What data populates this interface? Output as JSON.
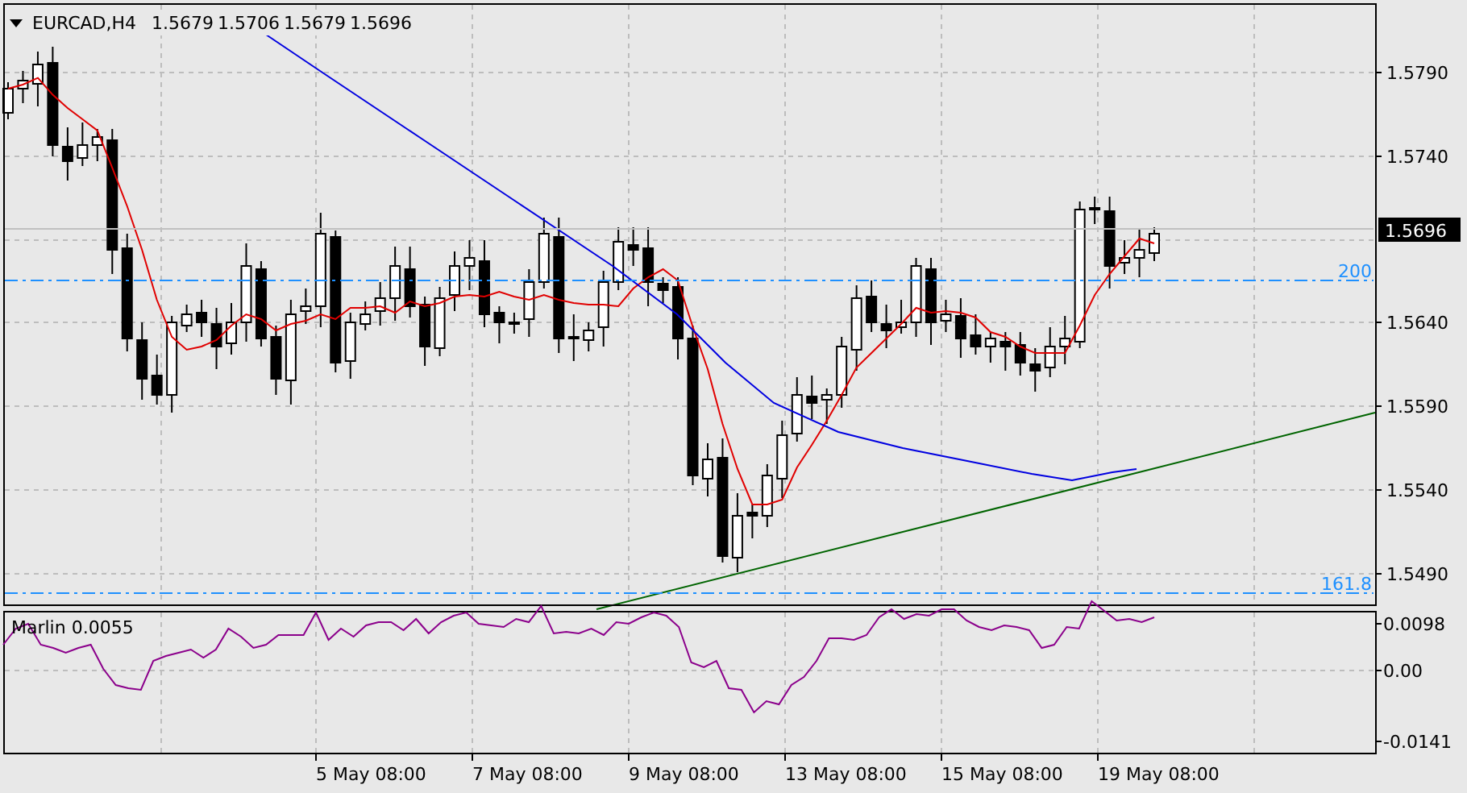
{
  "header": {
    "symbol": "EURCAD,H4",
    "quotes": [
      "1.5679",
      "1.5706",
      "1.5679",
      "1.5696"
    ]
  },
  "price_axis": [
    "1.5790",
    "1.5740",
    "1.5640",
    "1.5590",
    "1.5540",
    "1.5490"
  ],
  "current_price": "1.5696",
  "levels": [
    {
      "label": "200"
    },
    {
      "label": "161.8"
    }
  ],
  "indicator": {
    "label": "Marlin 0.0055",
    "axis": [
      "0.0098",
      "0.00",
      "-0.0141"
    ]
  },
  "time_axis": [
    "5 May 08:00",
    "7 May 08:00",
    "9 May 08:00",
    "13 May 08:00",
    "15 May 08:00",
    "19 May 08:00"
  ]
}
